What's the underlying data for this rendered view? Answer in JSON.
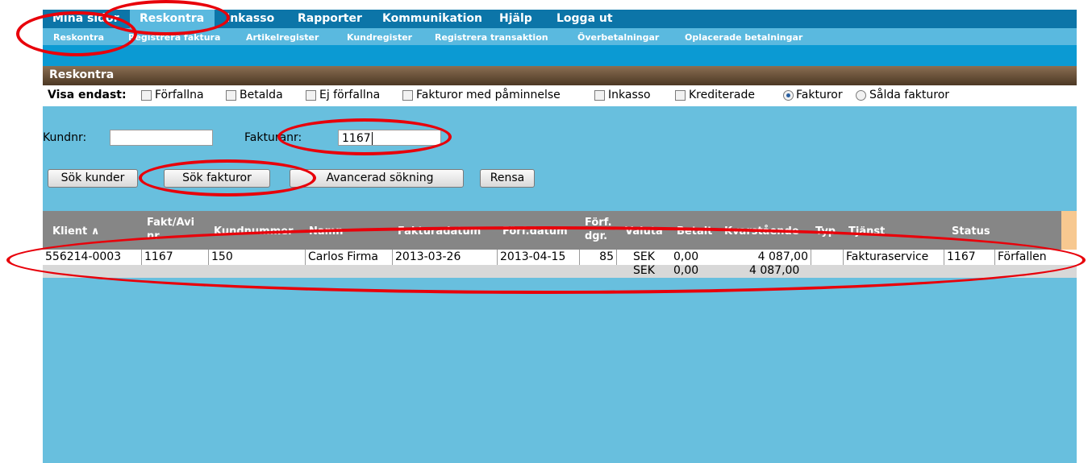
{
  "topnav": [
    "Mina sidor",
    "Reskontra",
    "Inkasso",
    "Rapporter",
    "Kommunikation",
    "Hjälp",
    "Logga ut"
  ],
  "subnav": [
    "Reskontra",
    "Registrera faktura",
    "Artikelregister",
    "Kundregister",
    "Registrera transaktion",
    "Överbetalningar",
    "Oplacerade betalningar"
  ],
  "section_title": "Reskontra",
  "filters": {
    "label": "Visa endast:",
    "checkboxes": [
      "Förfallna",
      "Betalda",
      "Ej förfallna",
      "Fakturor med påminnelse",
      "Inkasso",
      "Krediterade"
    ],
    "radios": [
      "Fakturor",
      "Sålda fakturor"
    ],
    "selected_radio": "Fakturor"
  },
  "search": {
    "kundnr_label": "Kundnr:",
    "kundnr_value": "",
    "fakturanr_label": "Fakturanr:",
    "fakturanr_value": "1167"
  },
  "buttons": {
    "search_customers": "Sök kunder",
    "search_invoices": "Sök fakturor",
    "advanced": "Avancerad sökning",
    "clear": "Rensa"
  },
  "table": {
    "headers": {
      "klient": "Klient",
      "fakt_line1": "Fakt/Avi",
      "fakt_line2": "nr",
      "kundnummer": "Kundnummer",
      "namn": "Namn",
      "fakturadatum": "Fakturadatum",
      "forfdatum": "Förf.datum",
      "forf_dgr_line1": "Förf.",
      "forf_dgr_line2": "dgr.",
      "valuta": "Valuta",
      "betalt": "Betalt",
      "kvarstaende": "Kvarstående",
      "typ": "Typ",
      "tjanst": "Tjänst",
      "status": "Status"
    },
    "row": {
      "klient": "556214-0003",
      "fakt": "1167",
      "kundnummer": "150",
      "namn": "Carlos Firma",
      "fakturadatum": "2013-03-26",
      "forfdatum": "2013-04-15",
      "forf_dgr": "85",
      "valuta": "SEK",
      "betalt": "0,00",
      "kvarstaende": "4 087,00",
      "typ": "",
      "tjanst": "Fakturaservice",
      "extra": "1167",
      "status": "Förfallen"
    },
    "summary": {
      "valuta": "SEK",
      "betalt": "0,00",
      "kvarstaende": "4 087,00"
    }
  },
  "colors": {
    "topnav": "#0c75a8",
    "subnav": "#5ab9df",
    "background": "#68bfde",
    "section_header": "#5e4630",
    "annotation": "#e8000a"
  }
}
